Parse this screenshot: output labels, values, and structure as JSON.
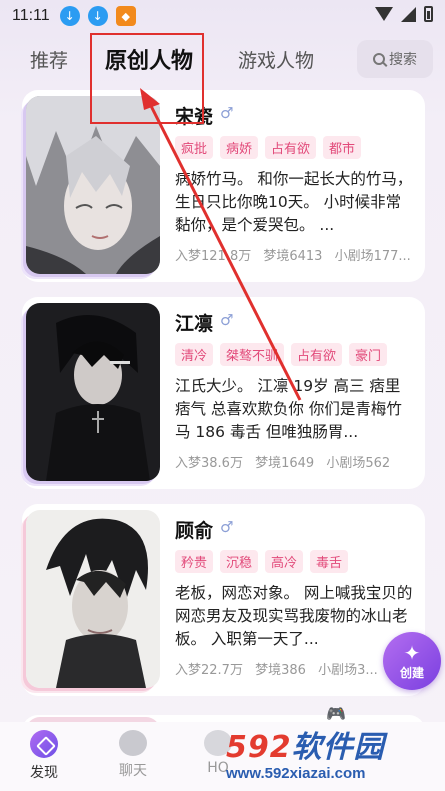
{
  "status_bar": {
    "time": "11:11",
    "icons": [
      "download-icon",
      "download-icon",
      "app-icon",
      "wifi-icon",
      "signal-icon",
      "battery-icon"
    ]
  },
  "tabs": [
    {
      "label": "推荐",
      "active": false
    },
    {
      "label": "原创人物",
      "active": true
    },
    {
      "label": "游戏人物",
      "active": false
    }
  ],
  "search": {
    "label": "搜索"
  },
  "characters": [
    {
      "name": "宋瓷",
      "gender_symbol": "♂",
      "tags": [
        "疯批",
        "病娇",
        "占有欲",
        "都市"
      ],
      "description": "病娇竹马。 和你一起长大的竹马，生日只比你晚10天。 小时候非常黏你，是个爱哭包。 ...",
      "stats": [
        "入梦121.8万",
        "梦境6413",
        "小剧场177..."
      ]
    },
    {
      "name": "江凛",
      "gender_symbol": "♂",
      "tags": [
        "清冷",
        "桀骜不驯",
        "占有欲",
        "豪门"
      ],
      "description": "江氏大少。 江凛 19岁 高三 痞里痞气 总喜欢欺负你 你们是青梅竹马 186 毒舌 但唯独肠胃...",
      "stats": [
        "入梦38.6万",
        "梦境1649",
        "小剧场562"
      ]
    },
    {
      "name": "顾俞",
      "gender_symbol": "♂",
      "tags": [
        "矜贵",
        "沉稳",
        "高冷",
        "毒舌"
      ],
      "description": "老板，网恋对象。 网上喊我宝贝的网恋男友及现实骂我废物的冰山老板。 入职第一天了...",
      "stats": [
        "入梦22.7万",
        "梦境386",
        "小剧场3..."
      ]
    }
  ],
  "create_button": {
    "label": "创建"
  },
  "bottom_nav": [
    {
      "label": "发现",
      "active": true
    },
    {
      "label": "聊天",
      "active": false
    },
    {
      "label": "HO",
      "active": false
    }
  ],
  "watermark": {
    "brand_prefix": "592",
    "brand_suffix": "软件园",
    "url": "www.592xiazai.com"
  },
  "colors": {
    "tag_bg": "#fde8ee",
    "tag_text": "#e24a7a",
    "annotation_red": "#e0302e",
    "accent_purple": "#8a4fe6"
  }
}
